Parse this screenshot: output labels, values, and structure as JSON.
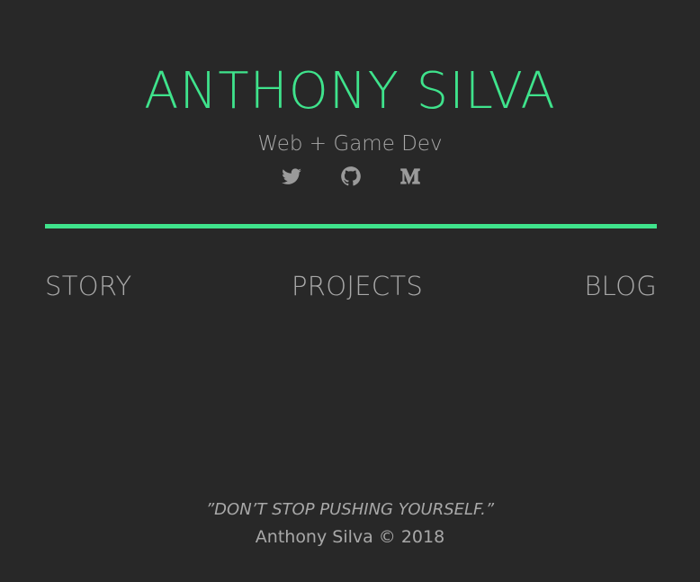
{
  "header": {
    "name": "ANTHONY SILVA",
    "subtitle": "Web + Game Dev"
  },
  "social": [
    {
      "icon": "twitter-icon"
    },
    {
      "icon": "github-icon"
    },
    {
      "icon": "medium-icon"
    }
  ],
  "nav": {
    "story": "STORY",
    "projects": "PROJECTS",
    "blog": "BLOG"
  },
  "footer": {
    "quote": "”DON’T STOP PUSHING YOURSELF.”",
    "copyright": "Anthony Silva © 2018"
  },
  "colors": {
    "background": "#282828",
    "accent": "#3fe38c",
    "text": "#a8a8a8"
  }
}
